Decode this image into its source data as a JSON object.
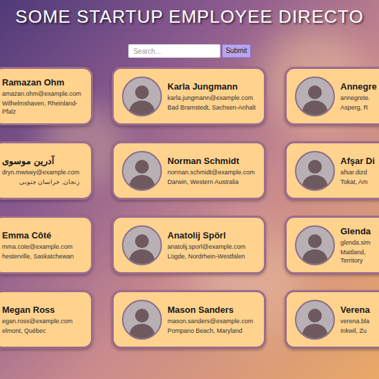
{
  "header": {
    "title": "SOME STARTUP EMPLOYEE DIRECTO"
  },
  "search": {
    "placeholder": "Search...",
    "button": "Submit"
  },
  "employees": [
    [
      {
        "kind": "text",
        "name": "Ramazan Ohm",
        "email": "amazan.ohm@example.com",
        "location": "Wilhelmshaven, Rheinland-\nPfalz"
      },
      {
        "kind": "photo",
        "name": "Karla Jungmann",
        "email": "karla.jungmann@example.com",
        "location": "Bad Bramstedt, Sachsen-Anhalt"
      },
      {
        "kind": "photo",
        "name": "Annegre",
        "email": "annegrete.",
        "location": "Asperg, R"
      }
    ],
    [
      {
        "kind": "text",
        "name": "آدرین موسوی",
        "email": "dryn.mwswy@example.com",
        "location": "زنجان, خراسان جنوبی"
      },
      {
        "kind": "photo",
        "name": "Norman Schmidt",
        "email": "norman.schmidt@example.com",
        "location": "Darwin, Western Australia"
      },
      {
        "kind": "photo",
        "name": "Afşar Di",
        "email": "afsar.dizd",
        "location": "Tokat, Am"
      }
    ],
    [
      {
        "kind": "text",
        "name": "Emma Côté",
        "email": "mma.cote@example.com",
        "location": "hesterville, Saskatchewan"
      },
      {
        "kind": "photo",
        "name": "Anatolij Spörl",
        "email": "anatolij.sporl@example.com",
        "location": "Lügde, Nordrhein-Westfalen"
      },
      {
        "kind": "photo",
        "name": "Glenda",
        "email": "glenda.sim",
        "location": "Maitland,\nTerritory"
      }
    ],
    [
      {
        "kind": "text",
        "name": "Megan Ross",
        "email": "egan.ross@example.com",
        "location": "elmont, Québec"
      },
      {
        "kind": "photo",
        "name": "Mason Sanders",
        "email": "mason.sanders@example.com",
        "location": "Pompano Beach, Maryland"
      },
      {
        "kind": "photo",
        "name": "Verena",
        "email": "verena.bla",
        "location": "Inkwil, Zu"
      }
    ]
  ]
}
